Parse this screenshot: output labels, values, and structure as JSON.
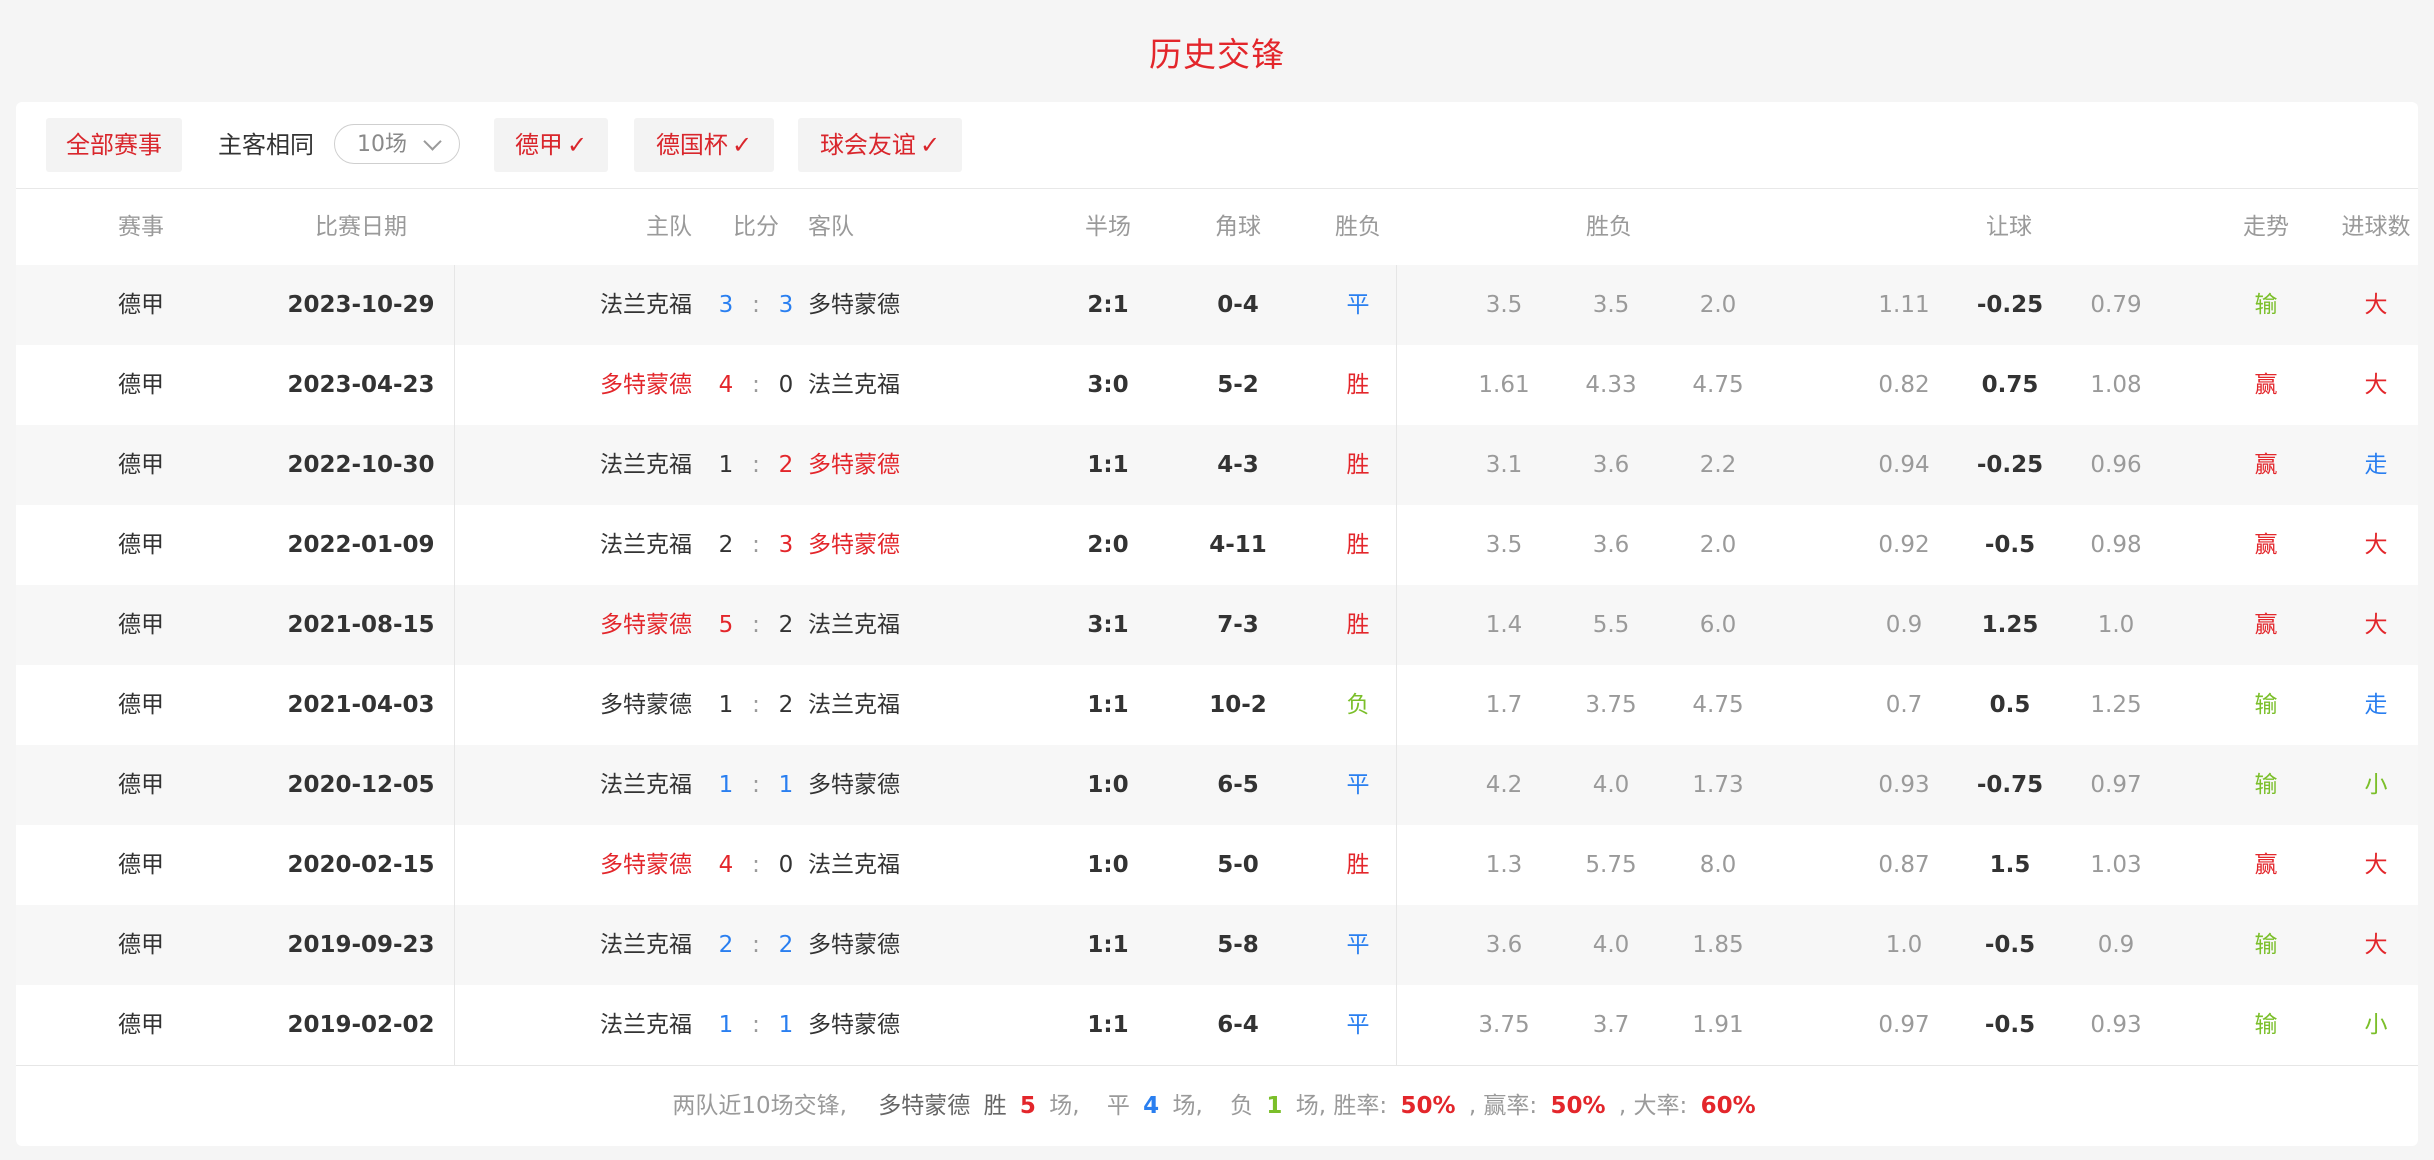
{
  "page_title": "历史交锋",
  "filters": {
    "all_events": "全部赛事",
    "same_home_away": "主客相同",
    "count_select": "10场",
    "leagues": [
      {
        "label": "德甲",
        "check": "✓"
      },
      {
        "label": "德国杯",
        "check": "✓"
      },
      {
        "label": "球会友谊",
        "check": "✓"
      }
    ]
  },
  "headers": {
    "event": "赛事",
    "date": "比赛日期",
    "home": "主队",
    "score": "比分",
    "away": "客队",
    "half": "半场",
    "corner": "角球",
    "result": "胜负",
    "odds_group": "胜负",
    "handicap_group": "让球",
    "trend": "走势",
    "goals": "进球数"
  },
  "colors": {
    "red": "#e3262b",
    "blue": "#2a7ff0",
    "green": "#7bbf2a"
  },
  "matches": [
    {
      "event": "德甲",
      "date": "2023-10-29",
      "home": "法兰克福",
      "home_hl": false,
      "hs": "3",
      "as": "3",
      "away": "多特蒙德",
      "away_hl": false,
      "score_color": "blue",
      "half": "2:1",
      "corner": "0-4",
      "result": "平",
      "o1": "3.5",
      "o2": "3.5",
      "o3": "2.0",
      "h1": "1.11",
      "h2": "-0.25",
      "h3": "0.79",
      "trend": "输",
      "goals": "大"
    },
    {
      "event": "德甲",
      "date": "2023-04-23",
      "home": "多特蒙德",
      "home_hl": true,
      "hs": "4",
      "as": "0",
      "away": "法兰克福",
      "away_hl": false,
      "score_color": "home",
      "half": "3:0",
      "corner": "5-2",
      "result": "胜",
      "o1": "1.61",
      "o2": "4.33",
      "o3": "4.75",
      "h1": "0.82",
      "h2": "0.75",
      "h3": "1.08",
      "trend": "赢",
      "goals": "大"
    },
    {
      "event": "德甲",
      "date": "2022-10-30",
      "home": "法兰克福",
      "home_hl": false,
      "hs": "1",
      "as": "2",
      "away": "多特蒙德",
      "away_hl": true,
      "score_color": "away",
      "half": "1:1",
      "corner": "4-3",
      "result": "胜",
      "o1": "3.1",
      "o2": "3.6",
      "o3": "2.2",
      "h1": "0.94",
      "h2": "-0.25",
      "h3": "0.96",
      "trend": "赢",
      "goals": "走"
    },
    {
      "event": "德甲",
      "date": "2022-01-09",
      "home": "法兰克福",
      "home_hl": false,
      "hs": "2",
      "as": "3",
      "away": "多特蒙德",
      "away_hl": true,
      "score_color": "away",
      "half": "2:0",
      "corner": "4-11",
      "result": "胜",
      "o1": "3.5",
      "o2": "3.6",
      "o3": "2.0",
      "h1": "0.92",
      "h2": "-0.5",
      "h3": "0.98",
      "trend": "赢",
      "goals": "大"
    },
    {
      "event": "德甲",
      "date": "2021-08-15",
      "home": "多特蒙德",
      "home_hl": true,
      "hs": "5",
      "as": "2",
      "away": "法兰克福",
      "away_hl": false,
      "score_color": "home",
      "half": "3:1",
      "corner": "7-3",
      "result": "胜",
      "o1": "1.4",
      "o2": "5.5",
      "o3": "6.0",
      "h1": "0.9",
      "h2": "1.25",
      "h3": "1.0",
      "trend": "赢",
      "goals": "大"
    },
    {
      "event": "德甲",
      "date": "2021-04-03",
      "home": "多特蒙德",
      "home_hl": false,
      "hs": "1",
      "as": "2",
      "away": "法兰克福",
      "away_hl": false,
      "score_color": "none",
      "half": "1:1",
      "corner": "10-2",
      "result": "负",
      "o1": "1.7",
      "o2": "3.75",
      "o3": "4.75",
      "h1": "0.7",
      "h2": "0.5",
      "h3": "1.25",
      "trend": "输",
      "goals": "走"
    },
    {
      "event": "德甲",
      "date": "2020-12-05",
      "home": "法兰克福",
      "home_hl": false,
      "hs": "1",
      "as": "1",
      "away": "多特蒙德",
      "away_hl": false,
      "score_color": "blue",
      "half": "1:0",
      "corner": "6-5",
      "result": "平",
      "o1": "4.2",
      "o2": "4.0",
      "o3": "1.73",
      "h1": "0.93",
      "h2": "-0.75",
      "h3": "0.97",
      "trend": "输",
      "goals": "小"
    },
    {
      "event": "德甲",
      "date": "2020-02-15",
      "home": "多特蒙德",
      "home_hl": true,
      "hs": "4",
      "as": "0",
      "away": "法兰克福",
      "away_hl": false,
      "score_color": "home",
      "half": "1:0",
      "corner": "5-0",
      "result": "胜",
      "o1": "1.3",
      "o2": "5.75",
      "o3": "8.0",
      "h1": "0.87",
      "h2": "1.5",
      "h3": "1.03",
      "trend": "赢",
      "goals": "大"
    },
    {
      "event": "德甲",
      "date": "2019-09-23",
      "home": "法兰克福",
      "home_hl": false,
      "hs": "2",
      "as": "2",
      "away": "多特蒙德",
      "away_hl": false,
      "score_color": "blue",
      "half": "1:1",
      "corner": "5-8",
      "result": "平",
      "o1": "3.6",
      "o2": "4.0",
      "o3": "1.85",
      "h1": "1.0",
      "h2": "-0.5",
      "h3": "0.9",
      "trend": "输",
      "goals": "大"
    },
    {
      "event": "德甲",
      "date": "2019-02-02",
      "home": "法兰克福",
      "home_hl": false,
      "hs": "1",
      "as": "1",
      "away": "多特蒙德",
      "away_hl": false,
      "score_color": "blue",
      "half": "1:1",
      "corner": "6-4",
      "result": "平",
      "o1": "3.75",
      "o2": "3.7",
      "o3": "1.91",
      "h1": "0.97",
      "h2": "-0.5",
      "h3": "0.93",
      "trend": "输",
      "goals": "小"
    }
  ],
  "summary": {
    "intro": "两队近10场交锋,",
    "team": "多特蒙德",
    "win_word": "胜",
    "win_count": "5",
    "win_unit": "场,",
    "draw_word": "平",
    "draw_count": "4",
    "draw_unit": "场,",
    "loss_word": "负",
    "loss_count": "1",
    "loss_unit": "场,",
    "win_rate_label": "胜率:",
    "win_rate": "50%",
    "cover_rate_label": ", 赢率:",
    "cover_rate": "50%",
    "over_rate_label": ", 大率:",
    "over_rate": "60%"
  }
}
